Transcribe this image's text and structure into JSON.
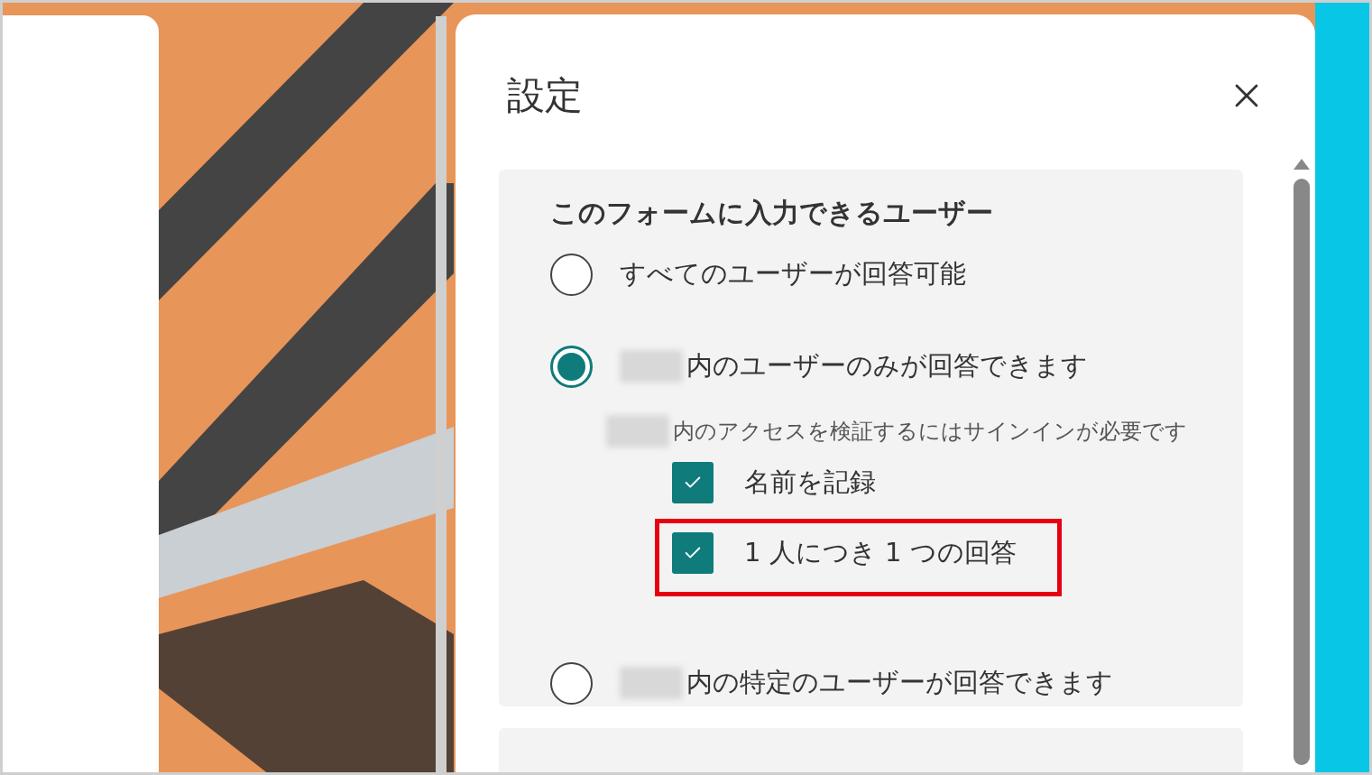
{
  "dialog": {
    "title": "設定",
    "section": {
      "heading": "このフォームに入力できるユーザー",
      "options": [
        {
          "kind": "radio",
          "label": "すべてのユーザーが回答可能",
          "selected": false,
          "redacted_prefix": false
        },
        {
          "kind": "radio",
          "label": "内のユーザーのみが回答できます",
          "selected": true,
          "redacted_prefix": true,
          "note": "内のアクセスを検証するにはサインインが必要です",
          "children": [
            {
              "kind": "checkbox",
              "label": "名前を記録",
              "checked": true,
              "highlighted": false
            },
            {
              "kind": "checkbox",
              "label": "1 人につき 1 つの回答",
              "checked": true,
              "highlighted": true
            }
          ]
        },
        {
          "kind": "radio",
          "label": "内の特定のユーザーが回答できます",
          "selected": false,
          "redacted_prefix": true
        }
      ]
    }
  }
}
